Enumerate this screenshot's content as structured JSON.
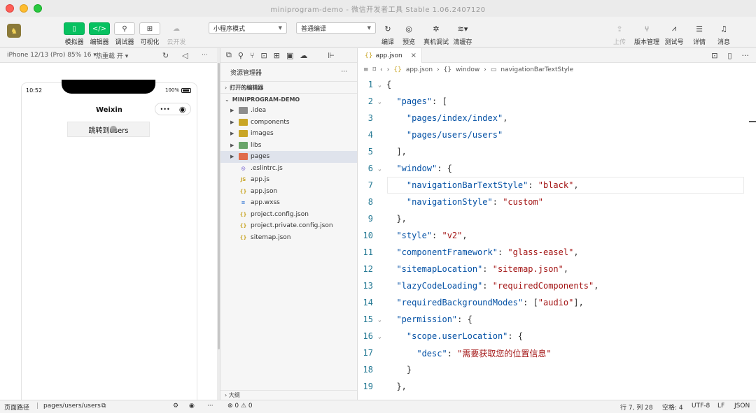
{
  "window": {
    "title": "miniprogram-demo - 微信开发者工具 Stable 1.06.2407120"
  },
  "toolbar": {
    "simulator": "模拟器",
    "editor": "编辑器",
    "debugger": "调试器",
    "visual": "可视化",
    "cloud": "云开发",
    "mode_select": "小程序模式",
    "compile_select": "普通编译",
    "compile": "编译",
    "preview": "预览",
    "real_debug": "真机调试",
    "clear_cache": "清缓存",
    "upload": "上传",
    "version": "版本管理",
    "test_account": "测试号",
    "details": "详情",
    "messages": "消息"
  },
  "simulator": {
    "device": "iPhone 12/13 (Pro) 85% 16 ▾",
    "hot_reload": "热重载 开 ▾",
    "time": "10:52",
    "battery": "100%",
    "nav_title": "Weixin",
    "capsule_more": "•••",
    "jump_button": "跳转到users"
  },
  "explorer": {
    "title": "资源管理器",
    "more": "···",
    "open_editors": "打开的编辑器",
    "project": "MINIPROGRAM-DEMO",
    "outline": "大纲",
    "items": [
      {
        "name": ".idea",
        "type": "folder",
        "icon": "folder-icon"
      },
      {
        "name": "components",
        "type": "folder",
        "icon": "folder-icon"
      },
      {
        "name": "images",
        "type": "folder",
        "icon": "folder-icon"
      },
      {
        "name": "libs",
        "type": "folder",
        "icon": "folder-icon"
      },
      {
        "name": "pages",
        "type": "folder",
        "icon": "folder-icon"
      },
      {
        "name": ".eslintrc.js",
        "type": "file",
        "icon": "eslint-icon"
      },
      {
        "name": "app.js",
        "type": "file",
        "icon": "js-icon"
      },
      {
        "name": "app.json",
        "type": "file",
        "icon": "json-icon"
      },
      {
        "name": "app.wxss",
        "type": "file",
        "icon": "wxss-icon"
      },
      {
        "name": "project.config.json",
        "type": "file",
        "icon": "json-icon"
      },
      {
        "name": "project.private.config.json",
        "type": "file",
        "icon": "json-icon"
      },
      {
        "name": "sitemap.json",
        "type": "file",
        "icon": "json-icon"
      }
    ],
    "selected": "pages"
  },
  "editor": {
    "tab": "app.json",
    "breadcrumb": [
      "app.json",
      "window",
      "navigationBarTextStyle"
    ],
    "lines": [
      {
        "n": "1",
        "text": "{"
      },
      {
        "n": "2",
        "text": "  \"pages\": ["
      },
      {
        "n": "3",
        "text": "    \"pages/index/index\","
      },
      {
        "n": "4",
        "text": "    \"pages/users/users\""
      },
      {
        "n": "5",
        "text": "  ],"
      },
      {
        "n": "6",
        "text": "  \"window\": {"
      },
      {
        "n": "7",
        "text": "    \"navigationBarTextStyle\": \"black\","
      },
      {
        "n": "8",
        "text": "    \"navigationStyle\": \"custom\""
      },
      {
        "n": "9",
        "text": "  },"
      },
      {
        "n": "10",
        "text": "  \"style\": \"v2\","
      },
      {
        "n": "11",
        "text": "  \"componentFramework\": \"glass-easel\","
      },
      {
        "n": "12",
        "text": "  \"sitemapLocation\": \"sitemap.json\","
      },
      {
        "n": "13",
        "text": "  \"lazyCodeLoading\": \"requiredComponents\","
      },
      {
        "n": "14",
        "text": "  \"requiredBackgroundModes\": [\"audio\"],"
      },
      {
        "n": "15",
        "text": "  \"permission\": {"
      },
      {
        "n": "16",
        "text": "    \"scope.userLocation\": {"
      },
      {
        "n": "17",
        "text": "      \"desc\": \"需要获取您的位置信息\""
      },
      {
        "n": "18",
        "text": "    }"
      },
      {
        "n": "19",
        "text": "  },"
      }
    ]
  },
  "status": {
    "page_path_label": "页面路径",
    "page_path": "pages/users/users",
    "problems": "⊗ 0 ⚠ 0",
    "cursor": "行 7, 列 28",
    "indent": "空格: 4",
    "encoding": "UTF-8",
    "eol": "LF",
    "language": "JSON"
  }
}
